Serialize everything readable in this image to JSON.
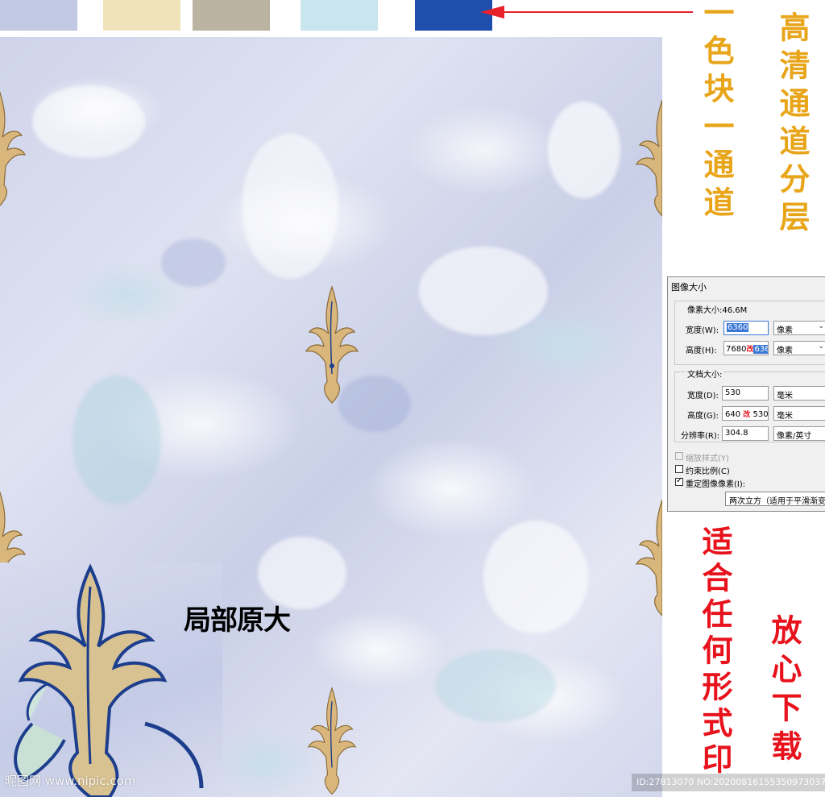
{
  "swatches": [
    {
      "name": "light-periwinkle",
      "color": "#c1c9e2"
    },
    {
      "name": "beige",
      "color": "#f0e3bc"
    },
    {
      "name": "taupe",
      "color": "#bbb3a1"
    },
    {
      "name": "pale-cyan",
      "color": "#c9e6ee"
    },
    {
      "name": "royal-blue",
      "color": "#1f4fad"
    }
  ],
  "captions": {
    "color_block_channel": "一色块一通道",
    "hd_channel_layers": "高清通道分层",
    "local_original_size": "局部原大",
    "suitable_any_print": "适合任何形式印",
    "download_assured": "放心下载"
  },
  "dialog": {
    "title": "图像大小",
    "pixel_dimensions": {
      "label": "像素大小:46.6M",
      "width_label": "宽度(W):",
      "width_value": "6360",
      "width_unit": "像素",
      "height_label": "高度(H):",
      "height_old": "7680",
      "height_mark": "改",
      "height_value": "6360",
      "height_unit": "像素"
    },
    "document_size": {
      "label": "文档大小:",
      "width_label": "宽度(D):",
      "width_value": "530",
      "width_unit": "毫米",
      "height_label": "高度(G):",
      "height_old": "640",
      "height_mark": "改",
      "height_value": "530",
      "height_unit": "毫米",
      "resolution_label": "分辨率(R):",
      "resolution_value": "304.8",
      "resolution_unit": "像素/英寸"
    },
    "options": {
      "scale_styles": "缩放样式(Y)",
      "constrain_proportions": "约束比例(C)",
      "resample": "重定图像像素(I):",
      "resample_method": "两次立方（适用于平滑渐变"
    }
  },
  "watermarks": {
    "site": "昵图网 www.nipic.com",
    "id_line": "ID:27813070 NO:20200816155350973037"
  },
  "colors": {
    "arrow": "#e8202a",
    "gold_text": "#e8a51a",
    "red_text": "#e8121c",
    "background_pattern": "#d4d8ec",
    "motif_gold": "#d9b77c",
    "motif_blue": "#1d3e8c"
  }
}
